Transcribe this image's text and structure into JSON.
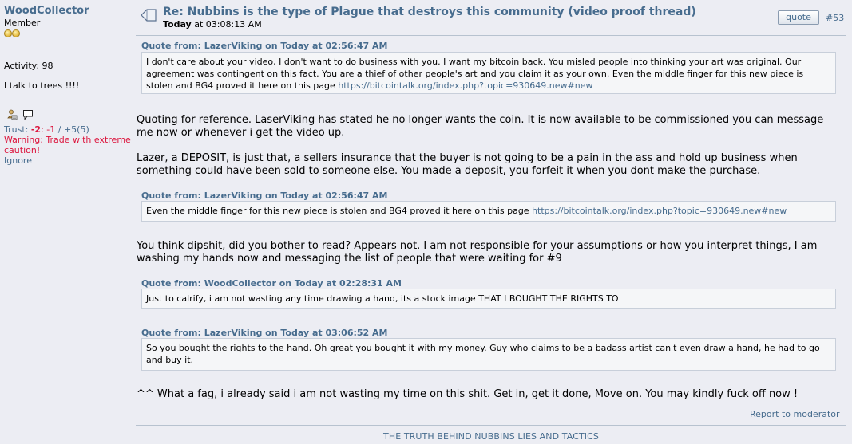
{
  "poster": {
    "name": "WoodCollector",
    "rank": "Member",
    "activity": "Activity: 98",
    "personal_text": "I talk to trees !!!!",
    "trust": {
      "label": "Trust: ",
      "neg": "-2",
      "sep1": ": ",
      "neg2": "-1",
      "rest": " / +5(5)"
    },
    "warning": "Warning: Trade with extreme caution!",
    "ignore": "Ignore"
  },
  "post": {
    "subject": "Re: Nubbins is the type of Plague that destroys this community (video proof thread)",
    "date_day": "Today",
    "date_time": " at 03:08:13 AM",
    "quote_button": "quote",
    "number": "#53"
  },
  "content": {
    "quote1": {
      "header": "Quote from: LazerViking on Today at 02:56:47 AM",
      "text": "I don't care about your video, I don't want to do business with you.  I want my bitcoin back.  You misled people into thinking your art was original.  Our agreement was contingent on this fact.  You are a thief of other people's art and you claim it as your own.  Even the middle finger for this new piece is stolen and BG4 proved it here on this page ",
      "link": "https://bitcointalk.org/index.php?topic=930649.new#new"
    },
    "para1": "Quoting for reference. LaserViking has stated he no longer wants the coin. It is now available to be commissioned you can message me now or whenever i get the video up.",
    "para2": "Lazer, a DEPOSIT, is just that, a sellers insurance that the buyer is not going to be a pain in the ass and hold up business when something could have been sold to someone else. You made a deposit, you forfeit it when you dont make the purchase.",
    "quote2": {
      "header": "Quote from: LazerViking on Today at 02:56:47 AM",
      "text": "Even the middle finger for this new piece is stolen and BG4 proved it here on this page ",
      "link": "https://bitcointalk.org/index.php?topic=930649.new#new"
    },
    "para3": "You think dipshit, did you bother to read? Appears not. I am not responsible for your assumptions or how you interpret things, I am washing my hands now and messaging the list of people that were waiting for #9",
    "quote3": {
      "header": "Quote from: WoodCollector on Today at 02:28:31 AM",
      "text": "Just to calrify, i am not wasting any time drawing a hand, its a stock image THAT I BOUGHT THE RIGHTS TO"
    },
    "quote4": {
      "header": "Quote from: LazerViking on Today at 03:06:52 AM",
      "text": "So you bought the rights to the hand.  Oh great you bought it with my money.  Guy who claims to be a badass artist can't even draw a hand, he had to go and buy it."
    },
    "para4": "^^ What a fag, i already said i am not wasting my time on this shit. Get in, get it done, Move on. You may kindly fuck off now !"
  },
  "report_link": "Report to moderator",
  "signature": "THE TRUTH BEHIND NUBBINS LIES AND TACTICS",
  "colors": {
    "link": "#476c8e",
    "warning": "#dc143c",
    "background": "#ecedf3",
    "quote_bg": "#f5f6f8"
  }
}
